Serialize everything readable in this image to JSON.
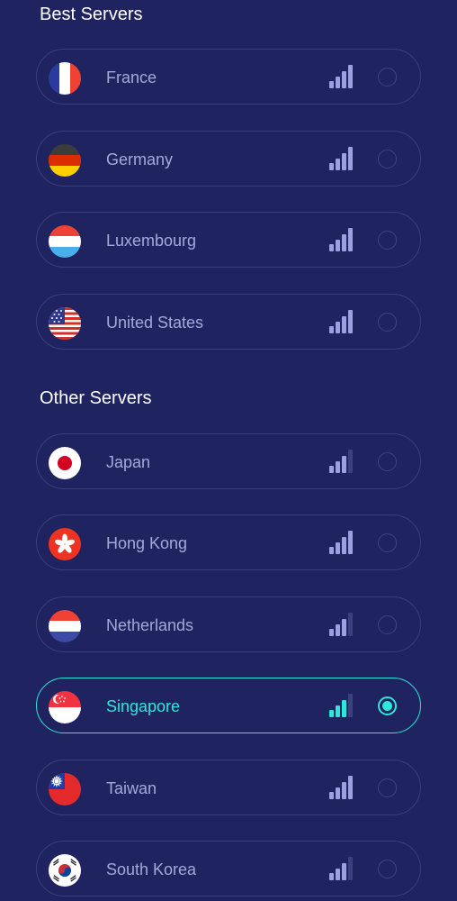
{
  "colors": {
    "background": "#1f2360",
    "row_border": "#3a3f7e",
    "text": "#a4a9d8",
    "accent": "#2ee6d9",
    "signal_active": "#9aa0e0",
    "signal_inactive": "#3b407f"
  },
  "best_servers": {
    "title": "Best Servers",
    "items": [
      {
        "name": "France",
        "flag_icon": "france-flag-icon",
        "signal_level": 4,
        "selected": false
      },
      {
        "name": "Germany",
        "flag_icon": "germany-flag-icon",
        "signal_level": 4,
        "selected": false
      },
      {
        "name": "Luxembourg",
        "flag_icon": "luxembourg-flag-icon",
        "signal_level": 4,
        "selected": false
      },
      {
        "name": "United States",
        "flag_icon": "united-states-flag-icon",
        "signal_level": 4,
        "selected": false
      }
    ]
  },
  "other_servers": {
    "title": "Other Servers",
    "items": [
      {
        "name": "Japan",
        "flag_icon": "japan-flag-icon",
        "signal_level": 3,
        "selected": false
      },
      {
        "name": "Hong Kong",
        "flag_icon": "hong-kong-flag-icon",
        "signal_level": 4,
        "selected": false
      },
      {
        "name": "Netherlands",
        "flag_icon": "netherlands-flag-icon",
        "signal_level": 3,
        "selected": false
      },
      {
        "name": "Singapore",
        "flag_icon": "singapore-flag-icon",
        "signal_level": 3,
        "selected": true
      },
      {
        "name": "Taiwan",
        "flag_icon": "taiwan-flag-icon",
        "signal_level": 4,
        "selected": false
      },
      {
        "name": "South Korea",
        "flag_icon": "south-korea-flag-icon",
        "signal_level": 3,
        "selected": false
      }
    ]
  }
}
